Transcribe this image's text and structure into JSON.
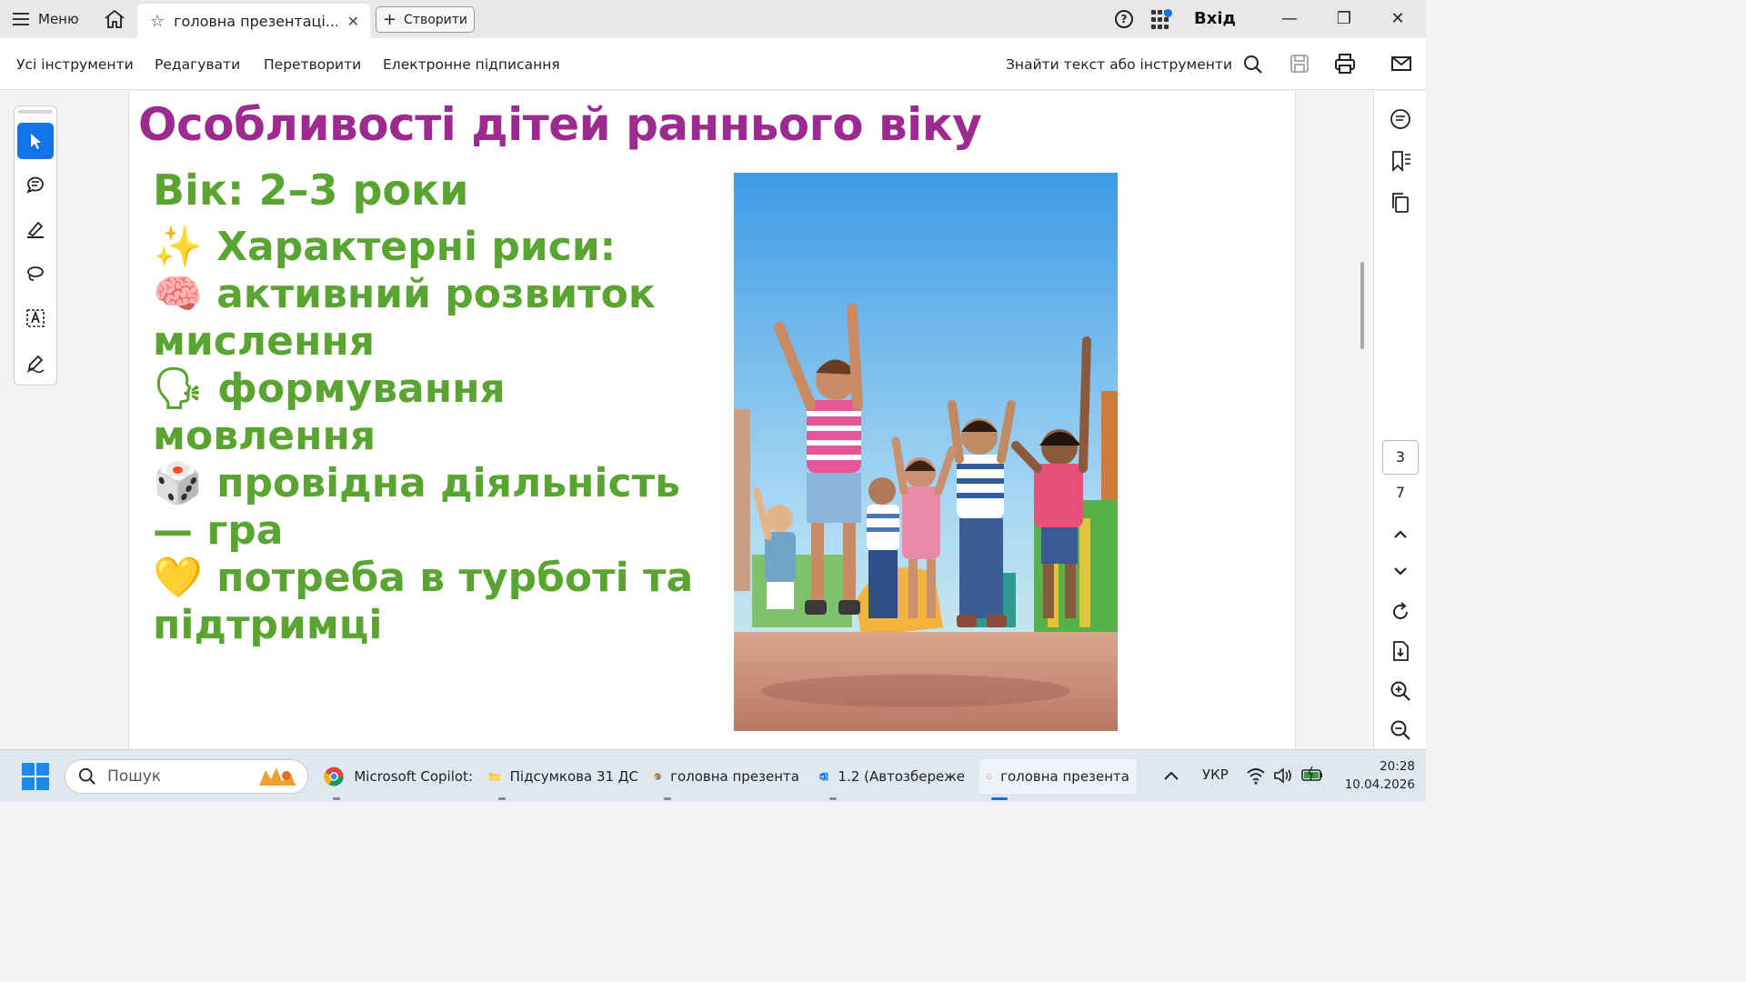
{
  "titlebar": {
    "menu_label": "Меню",
    "tab_title": "головна презентаці...",
    "create_label": "Створити",
    "help_glyph": "?",
    "login_label": "Вхід"
  },
  "toolbar": {
    "all_tools": "Усі інструменти",
    "edit": "Редагувати",
    "convert": "Перетворити",
    "esign": "Електронне підписання",
    "find": "Знайти текст або інструменти"
  },
  "slide": {
    "title": "Особливості дітей раннього віку",
    "age": "Вік: 2–3 роки",
    "lines": [
      "✨ Характерні риси:",
      "🧠 активний розвиток",
      "мислення",
      "🗣 формування",
      "мовлення",
      "🎲 провідна діяльність",
      "— гра",
      "💛 потреба в турботі та",
      "підтримці"
    ]
  },
  "right_panel": {
    "current_page": "3",
    "total_pages": "7"
  },
  "taskbar": {
    "search_placeholder": "Пошук",
    "apps": [
      {
        "label": "Microsoft Copilot:"
      },
      {
        "label": "Підсумкова 31 ДС"
      },
      {
        "label": "головна презента"
      },
      {
        "label": "1.2 (Автозбереже"
      },
      {
        "label": "головна презента"
      }
    ],
    "language": "УКР",
    "time": "20:28",
    "date": "10.04.2026"
  },
  "colors": {
    "accent": "#1473e6",
    "title_purple": "#9c2a8f",
    "text_green": "#5aa532"
  }
}
